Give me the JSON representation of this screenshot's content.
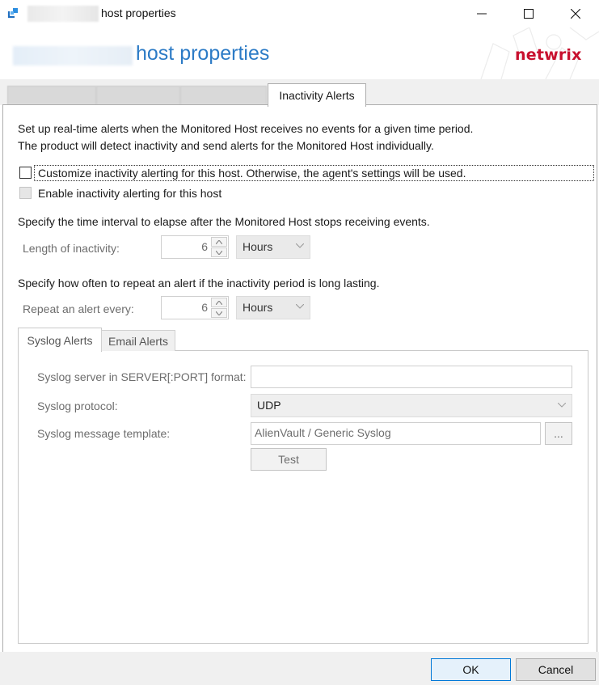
{
  "window": {
    "title": "host properties",
    "header_title": "host properties",
    "brand": "netwrix",
    "accent_color": "#2c7bc6",
    "brand_color": "#c8102e"
  },
  "tabs": {
    "active_label": "Inactivity Alerts"
  },
  "intro": {
    "line1": "Set up real-time alerts when the Monitored Host receives no events for a given time period.",
    "line2": "The product will detect inactivity and send alerts for the Monitored Host individually."
  },
  "options": {
    "customize_label": "Customize inactivity alerting for this host. Otherwise, the agent's settings will be used.",
    "customize_checked": false,
    "enable_label": "Enable inactivity alerting for this host",
    "enable_checked": false
  },
  "inactivity": {
    "section_text": "Specify the time interval to elapse after the Monitored Host stops receiving events.",
    "label": "Length of inactivity:",
    "value": "6",
    "unit": "Hours"
  },
  "repeat": {
    "section_text": "Specify how often to repeat an alert if the inactivity period is long lasting.",
    "label": "Repeat an alert every:",
    "value": "6",
    "unit": "Hours"
  },
  "alert_tabs": {
    "syslog_label": "Syslog Alerts",
    "email_label": "Email Alerts"
  },
  "syslog": {
    "server_label": "Syslog server in SERVER[:PORT] format:",
    "server_value": "",
    "protocol_label": "Syslog protocol:",
    "protocol_value": "UDP",
    "template_label": "Syslog message template:",
    "template_value": "AlienVault / Generic Syslog",
    "browse_label": "...",
    "test_label": "Test"
  },
  "footer": {
    "ok_label": "OK",
    "cancel_label": "Cancel"
  }
}
